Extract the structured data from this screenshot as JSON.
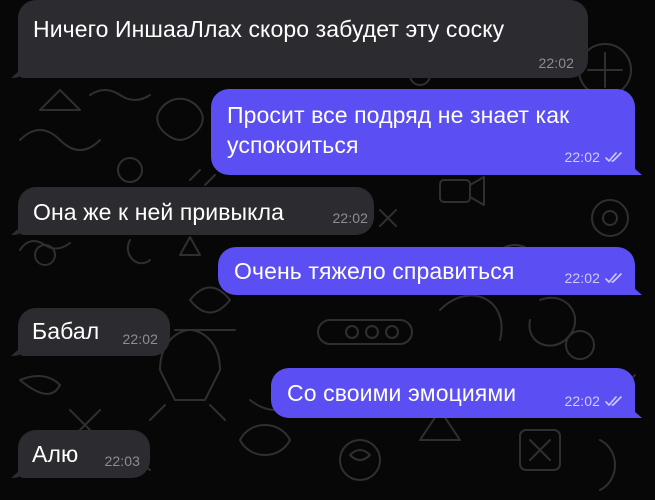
{
  "colors": {
    "background": "#070708",
    "incoming_bubble": "#2c2b30",
    "outgoing_bubble": "#5b4ef2",
    "incoming_time": "#8e8d93",
    "outgoing_time": "#cfcaff"
  },
  "messages": [
    {
      "direction": "incoming",
      "text": "Ничего ИншааЛлах скоро забудет эту соску",
      "time": "22:02"
    },
    {
      "direction": "outgoing",
      "text": "Просит все подряд не знает как\nуспокоиться",
      "time": "22:02",
      "status_icon": "double-check-icon"
    },
    {
      "direction": "incoming",
      "text": "Она же к ней привыкла",
      "time": "22:02"
    },
    {
      "direction": "outgoing",
      "text": "Очень тяжело справиться",
      "time": "22:02",
      "status_icon": "double-check-icon"
    },
    {
      "direction": "incoming",
      "text": "Бабал",
      "time": "22:02"
    },
    {
      "direction": "outgoing",
      "text": "Со своими эмоциями",
      "time": "22:02",
      "status_icon": "double-check-icon"
    },
    {
      "direction": "incoming",
      "text": "Алю",
      "time": "22:03"
    }
  ]
}
